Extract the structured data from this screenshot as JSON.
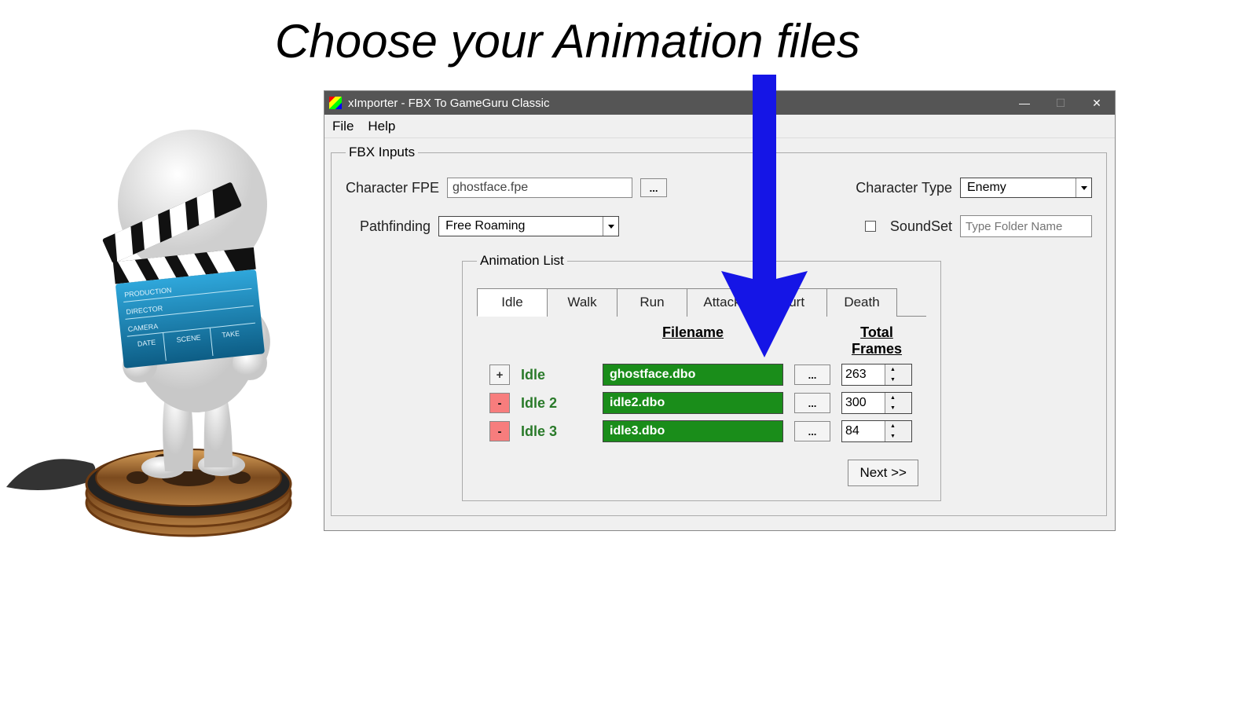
{
  "pageTitle": "Choose your Animation files",
  "window": {
    "title": "xImporter - FBX To GameGuru Classic",
    "menu": {
      "file": "File",
      "help": "Help"
    }
  },
  "fbx": {
    "legend": "FBX Inputs",
    "fpeLabel": "Character FPE",
    "fpeValue": "ghostface.fpe",
    "browseLabel": "...",
    "charTypeLabel": "Character Type",
    "charTypeValue": "Enemy",
    "pathfindLabel": "Pathfinding",
    "pathfindValue": "Free Roaming",
    "soundSetLabel": "SoundSet",
    "soundSetPlaceholder": "Type Folder Name"
  },
  "animList": {
    "legend": "Animation List",
    "tabs": [
      "Idle",
      "Walk",
      "Run",
      "Attack",
      "Hurt",
      "Death"
    ],
    "activeTab": 0,
    "headers": {
      "filename": "Filename",
      "frames": "Total Frames"
    },
    "rows": [
      {
        "btn": "+",
        "btnClass": "add",
        "label": "Idle",
        "filename": "ghostface.dbo",
        "frames": "263"
      },
      {
        "btn": "-",
        "btnClass": "del",
        "label": "Idle 2",
        "filename": "idle2.dbo",
        "frames": "300"
      },
      {
        "btn": "-",
        "btnClass": "del",
        "label": "Idle 3",
        "filename": "idle3.dbo",
        "frames": "84"
      }
    ],
    "nextLabel": "Next >>"
  }
}
